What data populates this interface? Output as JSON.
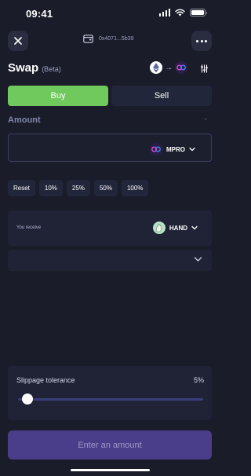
{
  "status_bar": {
    "time": "09:41"
  },
  "header": {
    "wallet_address": "0x4071...5b39"
  },
  "title": {
    "text": "Swap",
    "badge": "(Beta)"
  },
  "trade_toggle": {
    "buy_label": "Buy",
    "sell_label": "Sell",
    "active": "Buy"
  },
  "amount": {
    "label": "Amount",
    "value": "",
    "token": "MPRO"
  },
  "percent_buttons": [
    "Reset",
    "10%",
    "25%",
    "50%",
    "100%"
  ],
  "receive": {
    "label": "You receive",
    "token": "HAND"
  },
  "slippage": {
    "label": "Slippage tolerance",
    "value_text": "5%",
    "level": 0.05
  },
  "cta": {
    "label": "Enter an amount"
  },
  "colors": {
    "background": "#1a1c2a",
    "buy_active": "#6fc95d",
    "cta_disabled": "#4a3e8a",
    "card": "#202336",
    "slider_track": "#3a3d7a"
  },
  "icons": [
    "close-icon",
    "more-icon",
    "wallet-icon",
    "eth-icon",
    "arrow-right-icon",
    "mpro-icon",
    "settings-icon",
    "chevron-down-icon",
    "hand-icon"
  ]
}
